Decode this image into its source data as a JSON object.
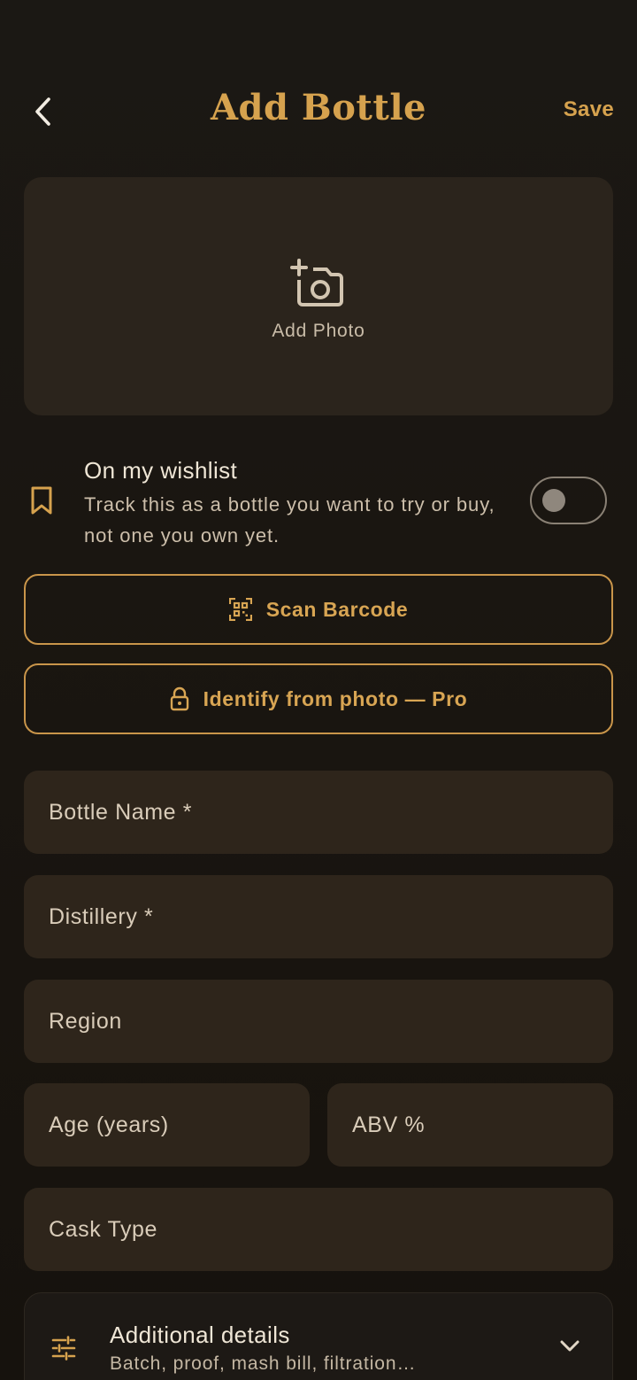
{
  "header": {
    "title": "Add Bottle",
    "save_label": "Save",
    "back_icon": "chevron-left-icon"
  },
  "photo": {
    "label": "Add Photo",
    "icon": "add-photo-camera-icon"
  },
  "wishlist": {
    "title": "On my wishlist",
    "description": "Track this as a bottle you want to try or buy, not one you own yet.",
    "toggle_on": false,
    "icon": "bookmark-icon"
  },
  "actions": {
    "scan_label": "Scan Barcode",
    "scan_icon": "qr-scan-icon",
    "identify_label": "Identify from photo — Pro",
    "identify_icon": "lock-icon"
  },
  "fields": {
    "bottle_name": "Bottle Name *",
    "distillery": "Distillery *",
    "region": "Region",
    "age": "Age (years)",
    "abv": "ABV %",
    "cask_type": "Cask Type"
  },
  "details": {
    "title": "Additional details",
    "subtitle": "Batch, proof, mash bill, filtration…",
    "icon": "tune-icon",
    "chevron": "chevron-down-icon"
  },
  "colors": {
    "accent": "#d6a24e",
    "background": "#1a1611",
    "field": "#2e251b",
    "photo_box": "#2b241c"
  }
}
